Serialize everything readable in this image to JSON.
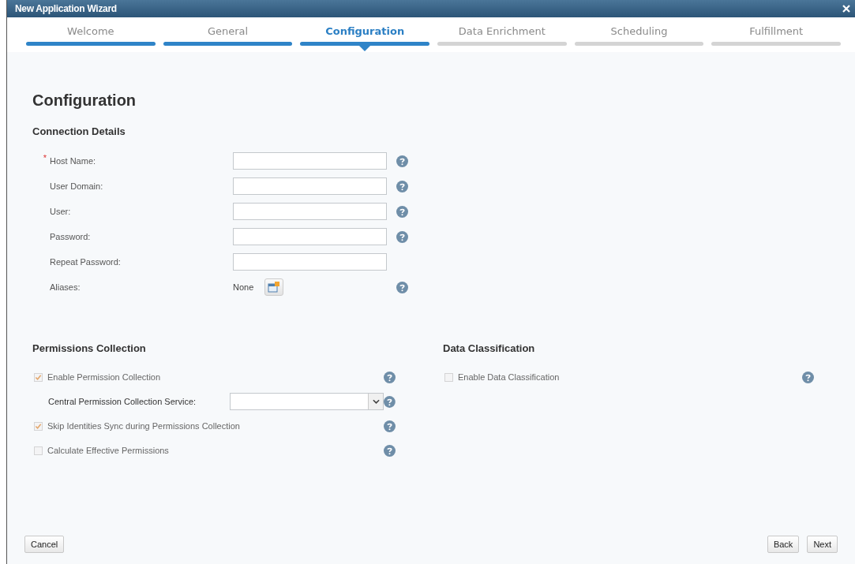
{
  "window": {
    "title": "New Application Wizard"
  },
  "steps": [
    {
      "label": "Welcome",
      "completed": true,
      "selected": false
    },
    {
      "label": "General",
      "completed": true,
      "selected": false
    },
    {
      "label": "Configuration",
      "completed": true,
      "selected": true
    },
    {
      "label": "Data Enrichment",
      "completed": false,
      "selected": false
    },
    {
      "label": "Scheduling",
      "completed": false,
      "selected": false
    },
    {
      "label": "Fulfillment",
      "completed": false,
      "selected": false
    }
  ],
  "page_title": "Configuration",
  "connection_details": {
    "heading": "Connection Details",
    "fields": [
      {
        "kind": "text",
        "label": "Host Name:",
        "required_mark": "*",
        "help": true
      },
      {
        "kind": "text",
        "label": "User Domain:",
        "help": true
      },
      {
        "kind": "text",
        "label": "User:",
        "help": true
      },
      {
        "kind": "text",
        "label": "Password:",
        "help": true
      },
      {
        "kind": "text",
        "label": "Repeat Password:",
        "help": false
      },
      {
        "kind": "aliases",
        "label": "Aliases:",
        "value": "None",
        "help": true
      }
    ]
  },
  "permissions_collection": {
    "heading": "Permissions Collection",
    "options": [
      {
        "kind": "checkbox",
        "label": "Enable Permission Collection",
        "checked": true
      },
      {
        "kind": "dropdown",
        "label": "Central Permission Collection Service:"
      },
      {
        "kind": "checkbox",
        "label": "Skip Identities Sync during Permissions Collection",
        "checked": true
      },
      {
        "kind": "checkbox",
        "label": "Calculate Effective Permissions",
        "checked": false
      }
    ]
  },
  "data_classification": {
    "heading": "Data Classification",
    "options": [
      {
        "kind": "checkbox",
        "label": "Enable Data Classification",
        "checked": false
      }
    ]
  },
  "buttons": {
    "cancel": "Cancel",
    "back": "Back",
    "next": "Next"
  }
}
